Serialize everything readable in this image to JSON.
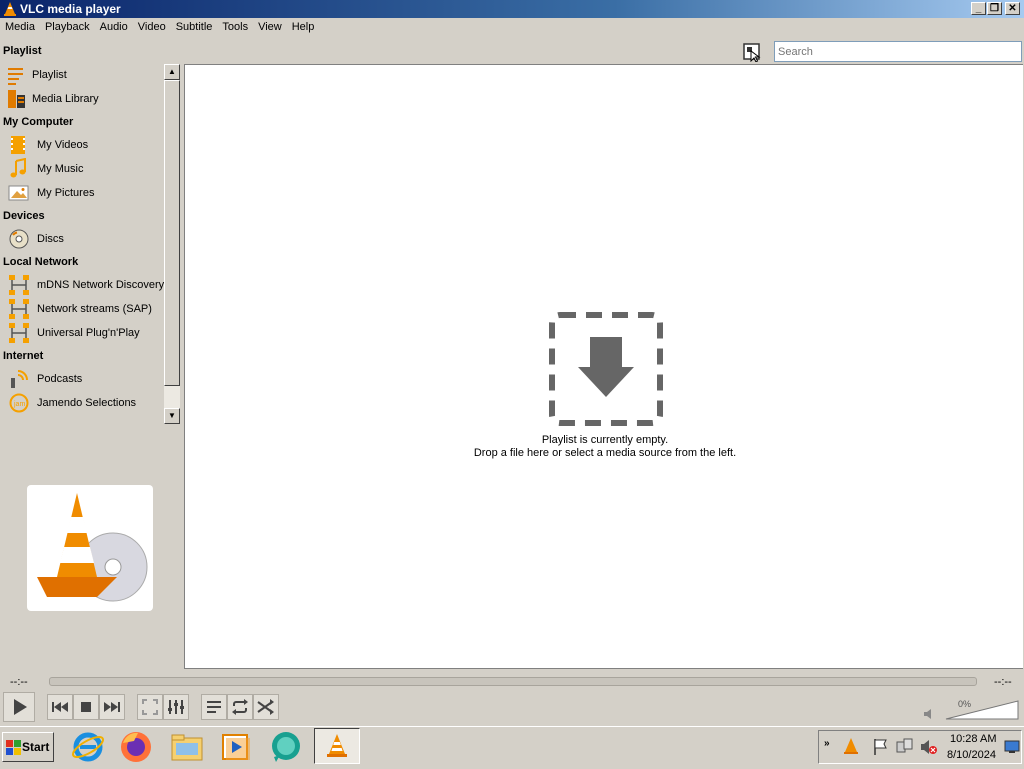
{
  "window": {
    "title": "VLC media player"
  },
  "menu": [
    "Media",
    "Playback",
    "Audio",
    "Video",
    "Subtitle",
    "Tools",
    "View",
    "Help"
  ],
  "sidebar": {
    "sections": [
      {
        "title": "Playlist",
        "items": [
          {
            "label": "Playlist",
            "icon": "playlist-icon"
          },
          {
            "label": "Media Library",
            "icon": "media-library-icon"
          }
        ]
      },
      {
        "title": "My Computer",
        "items": [
          {
            "label": "My Videos",
            "icon": "film-icon"
          },
          {
            "label": "My Music",
            "icon": "music-note-icon"
          },
          {
            "label": "My Pictures",
            "icon": "picture-icon"
          }
        ]
      },
      {
        "title": "Devices",
        "items": [
          {
            "label": "Discs",
            "icon": "disc-icon"
          }
        ]
      },
      {
        "title": "Local Network",
        "items": [
          {
            "label": "mDNS Network Discovery",
            "icon": "network-icon"
          },
          {
            "label": "Network streams (SAP)",
            "icon": "network-icon"
          },
          {
            "label": "Universal Plug'n'Play",
            "icon": "network-icon"
          }
        ]
      },
      {
        "title": "Internet",
        "items": [
          {
            "label": "Podcasts",
            "icon": "podcast-icon"
          },
          {
            "label": "Jamendo Selections",
            "icon": "jamendo-icon"
          }
        ]
      }
    ]
  },
  "search": {
    "placeholder": "Search"
  },
  "playlist": {
    "empty_line1": "Playlist is currently empty.",
    "empty_line2": "Drop a file here or select a media source from the left."
  },
  "controls": {
    "time_elapsed": "--:--",
    "time_total": "--:--",
    "volume": "0%"
  },
  "taskbar": {
    "start_label": "Start",
    "clock_time": "10:28 AM",
    "clock_date": "8/10/2024"
  },
  "colors": {
    "vlc_orange": "#f08c00",
    "titlebar": "#0a246a",
    "background": "#d4d0c8"
  }
}
